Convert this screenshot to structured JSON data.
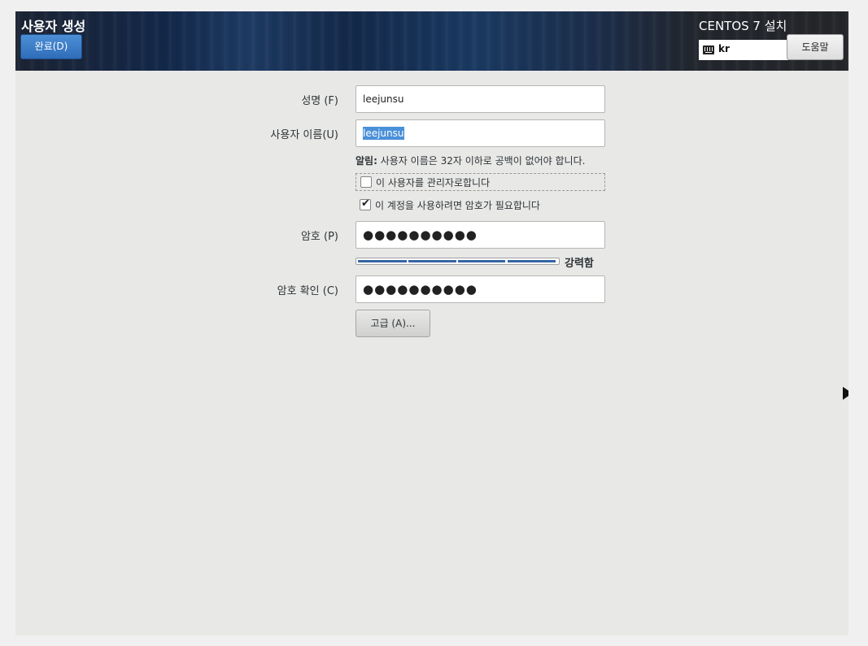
{
  "header": {
    "title": "사용자 생성",
    "done_button": "완료(D)",
    "install_title": "CENTOS 7 설치",
    "keyboard_layout": "kr",
    "help_button": "도움말"
  },
  "form": {
    "fullname": {
      "label": "성명 (F)",
      "value": "leejunsu"
    },
    "username": {
      "label": "사용자 이름(U)",
      "value": "leejunsu"
    },
    "notice": {
      "label": "알림:",
      "text": "사용자 이름은 32자 이하로 공백이 없어야 합니다."
    },
    "admin_checkbox": {
      "label": "이 사용자를 관리자로합니다",
      "checked": false
    },
    "password_required_checkbox": {
      "label": "이 계정을 사용하려면 암호가 필요합니다",
      "checked": true
    },
    "password": {
      "label": "암호 (P)",
      "masked_value": "●●●●●●●●●●"
    },
    "password_strength": {
      "label": "강력함",
      "level": 1.0,
      "color": "#3465a4"
    },
    "confirm_password": {
      "label": "암호 확인 (C)",
      "masked_value": "●●●●●●●●●●"
    },
    "advanced_button": "고급 (A)..."
  },
  "icons": {
    "keyboard": "keyboard-icon",
    "check": "✔",
    "cursor": "mouse-pointer-icon"
  },
  "colors": {
    "header": "#1a3a62",
    "primary_button": "#3e7fc8",
    "content_background": "#e8e8e7",
    "selection": "#4a90d9"
  }
}
